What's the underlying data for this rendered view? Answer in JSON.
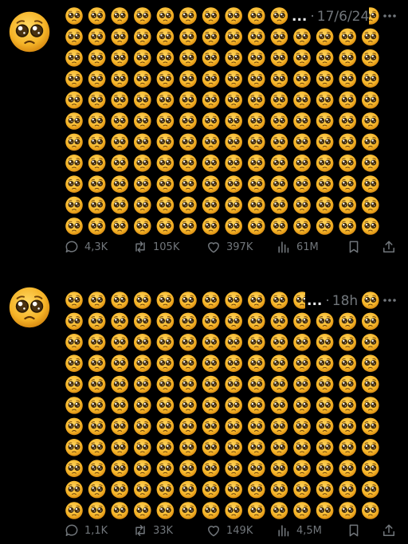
{
  "posts": [
    {
      "timestamp": "17/6/24",
      "overflow_marker": "...",
      "separator": "·",
      "emoji_grid": {
        "rows": 11,
        "cols": 14,
        "emoji": "pleading-face"
      },
      "stats": {
        "replies": "4,3K",
        "reposts": "105K",
        "likes": "397K",
        "views": "61M"
      }
    },
    {
      "timestamp": "18h",
      "overflow_marker": "...",
      "separator": "·",
      "emoji_grid": {
        "rows": 11,
        "cols": 14,
        "emoji": "pleading-face"
      },
      "stats": {
        "replies": "1,1K",
        "reposts": "33K",
        "likes": "149K",
        "views": "4,5M"
      }
    }
  ],
  "colors": {
    "background": "#000000",
    "muted_text": "#71767b",
    "emoji_face": "#f7b928",
    "emoji_dark": "#2a1a05"
  },
  "icons": [
    "reply-icon",
    "repost-icon",
    "like-icon",
    "views-icon",
    "bookmark-icon",
    "share-icon",
    "more-icon"
  ]
}
